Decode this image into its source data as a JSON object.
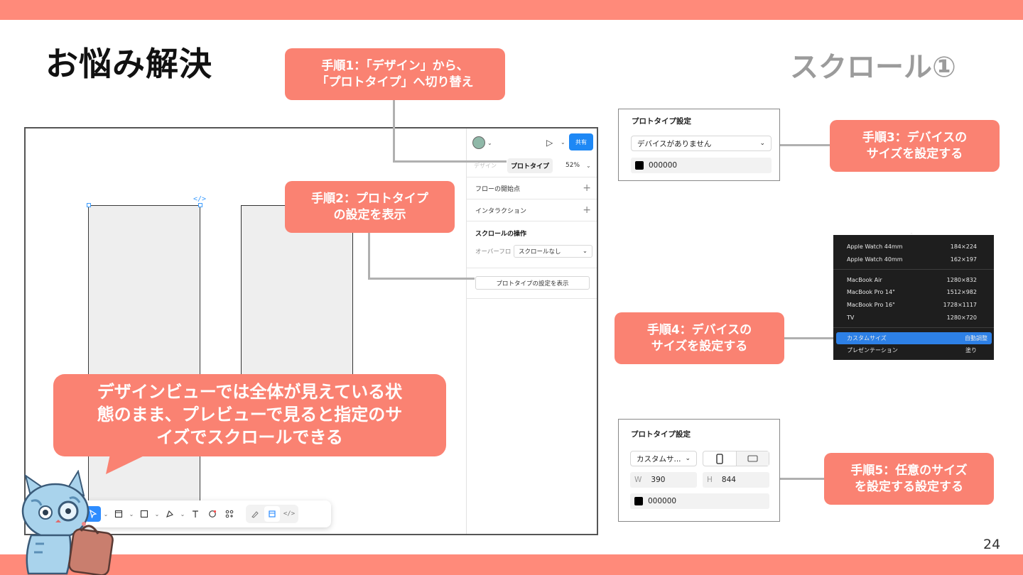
{
  "slide": {
    "title": "お悩み解決",
    "subtitle": "スクロール①",
    "page_number": "24"
  },
  "callouts": {
    "step1": "手順1：「デザイン」から、\n「プロトタイプ」へ切り替え",
    "step2": "手順2：プロトタイプ\nの設定を表示",
    "step3": "手順3：デバイスの\nサイズを設定する",
    "step4": "手順4：デバイスの\nサイズを設定する",
    "step5": "手順5：任意のサイズ\nを設定する設定する",
    "note": "デザインビューでは全体が見えている状\n態のまま、プレビューで見ると指定のサ\nイズでスクロールできる"
  },
  "figma": {
    "share_label": "共有",
    "tab_design": "デザイン",
    "tab_prototype": "プロトタイプ",
    "zoom": "52%",
    "flow_start_label": "フローの開始点",
    "interaction_label": "インタラクション",
    "scroll_section_title": "スクロールの操作",
    "overflow_label": "オーバーフロー",
    "overflow_value": "スクロールなし",
    "show_proto_settings_button": "プロトタイプの設定を表示",
    "code_tag": "</>",
    "help_label": "?"
  },
  "proto_settings_1": {
    "title": "プロトタイプ設定",
    "device_select": "デバイスがありません",
    "bg_color": "000000"
  },
  "device_menu": {
    "items": [
      {
        "name": "Apple Watch 44mm",
        "size": "184×224"
      },
      {
        "name": "Apple Watch 40mm",
        "size": "162×197"
      },
      {
        "name": "MacBook Air",
        "size": "1280×832"
      },
      {
        "name": "MacBook Pro 14\"",
        "size": "1512×982"
      },
      {
        "name": "MacBook Pro 16\"",
        "size": "1728×1117"
      },
      {
        "name": "TV",
        "size": "1280×720"
      },
      {
        "name": "カスタムサイズ",
        "size": "自動調整"
      },
      {
        "name": "プレゼンテーション",
        "size": "塗り"
      }
    ]
  },
  "proto_settings_2": {
    "title": "プロトタイプ設定",
    "device_select": "カスタムサ...",
    "width_label": "W",
    "width_value": "390",
    "height_label": "H",
    "height_value": "844",
    "bg_color": "000000"
  },
  "colors": {
    "accent": "#fa8272",
    "band": "#ff8a7a",
    "figma_blue": "#1e88f5",
    "menu_highlight": "#2d80e6"
  }
}
